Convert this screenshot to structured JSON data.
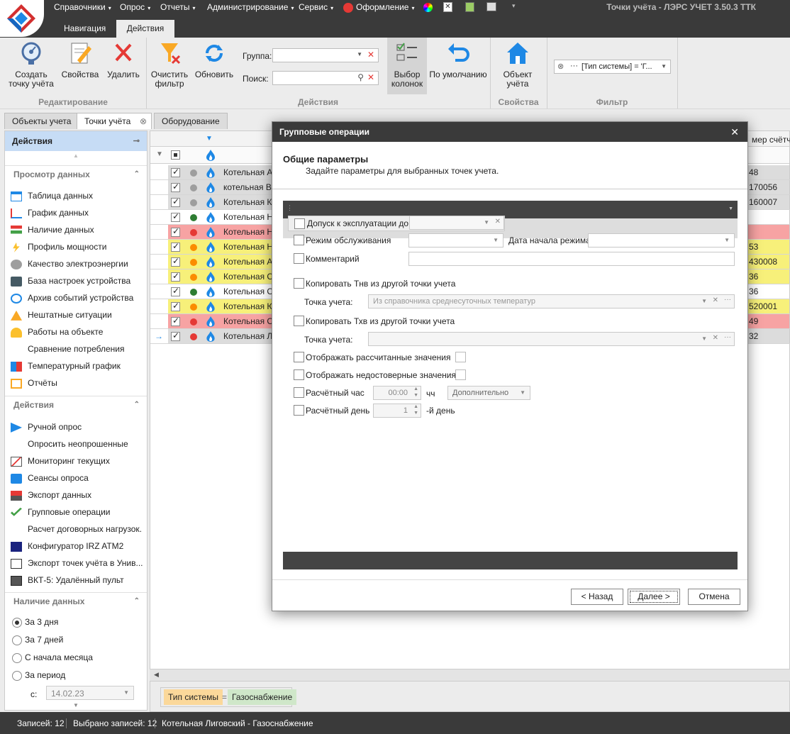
{
  "window": {
    "title": "Точки учёта - ЛЭРС УЧЕТ 3.50.3 ТТК"
  },
  "menu": [
    "Справочники",
    "Опрос",
    "Отчеты",
    "Администрирование",
    "Сервис",
    "Оформление"
  ],
  "ribbon_tabs": [
    "Навигация",
    "Действия"
  ],
  "ribbon": {
    "create": "Создать точку учёта",
    "properties": "Свойства",
    "delete": "Удалить",
    "group_edit": "Редактирование",
    "clear_filter": "Очистить фильтр",
    "refresh": "Обновить",
    "group_label": "Группа:",
    "search_label": "Поиск:",
    "columns": "Выбор колонок",
    "default": "По умолчанию",
    "group_actions": "Действия",
    "object": "Объект учёта",
    "group_props": "Свойства",
    "filter_value": "[Тип системы] = 'Г...",
    "group_filter": "Фильтр"
  },
  "doc_tabs": [
    "Объекты учета",
    "Точки учёта",
    "Оборудование"
  ],
  "left_panel": {
    "header": "Действия",
    "section_view": "Просмотр данных",
    "view_items": [
      "Таблица данных",
      "График данных",
      "Наличие данных",
      "Профиль мощности",
      "Качество электроэнергии",
      "База настроек устройства",
      "Архив событий устройства",
      "Нештатные ситуации",
      "Работы на объекте",
      "Сравнение потребления",
      "Температурный график",
      "Отчёты"
    ],
    "section_actions": "Действия",
    "action_items": [
      "Ручной опрос",
      "Опросить неопрошенные",
      "Мониторинг текущих",
      "Сеансы опроса",
      "Экспорт данных",
      "Групповые операции",
      "Расчет договорных нагрузок.",
      "Конфигуратор IRZ ATM2",
      "Экспорт точек учёта в Унив...",
      "ВКТ-5: Удалённый пульт"
    ],
    "section_avail": "Наличие данных",
    "radios": [
      "За 3 дня",
      "За 7 дней",
      "С начала месяца",
      "За период"
    ],
    "date_label": "с:",
    "date_value": "14.02.23"
  },
  "grid": {
    "col_counter": "мер счётчик",
    "rows": [
      {
        "name": "Котельная А...",
        "num": "48",
        "status": "gray",
        "bg": "#dcdcdc"
      },
      {
        "name": "котельная Во...",
        "num": "170056",
        "status": "gray",
        "bg": "#dcdcdc"
      },
      {
        "name": "Котельная Ко...",
        "num": "160007",
        "status": "gray",
        "bg": "#dcdcdc"
      },
      {
        "name": "Котельная Не...",
        "num": "",
        "status": "green",
        "bg": "#ffffff"
      },
      {
        "name": "Котельная Не...",
        "num": "",
        "status": "red",
        "bg": "#f7a3a3"
      },
      {
        "name": "Котельная Не...",
        "num": "53",
        "status": "orange",
        "bg": "#f7f07a"
      },
      {
        "name": "Котельная А...",
        "num": "430008",
        "status": "orange",
        "bg": "#f7f07a"
      },
      {
        "name": "Котельная Сл...",
        "num": "36",
        "status": "orange",
        "bg": "#f7f07a"
      },
      {
        "name": "Котельная Сл...",
        "num": "36",
        "status": "green",
        "bg": "#ffffff"
      },
      {
        "name": "Котельная Ю...",
        "num": "520001",
        "status": "orange",
        "bg": "#f7f07a"
      },
      {
        "name": "Котельная Со...",
        "num": "49",
        "status": "red",
        "bg": "#f7a3a3"
      },
      {
        "name": "Котельная Ли...",
        "num": "32",
        "status": "red",
        "bg": "#dcdcdc"
      }
    ]
  },
  "filter_chips": {
    "field": "Тип системы",
    "op": "=",
    "value": "Газоснабжение"
  },
  "status": {
    "records": "Записей: 12",
    "selected": "Выбрано записей: 12",
    "current": "Котельная Лиговский - Газоснабжение"
  },
  "dialog": {
    "title": "Групповые операции",
    "heading": "Общие параметры",
    "subheading": "Задайте параметры для выбранных точек учета.",
    "opt_admission": "Допуск к эксплуатации до",
    "opt_mode": "Режим обслуживания",
    "mode_date_label": "Дата начала режима:",
    "opt_comment": "Комментарий",
    "opt_copy_tnv": "Копировать Тнв из другой точки учета",
    "point_label": "Точка учета:",
    "point_placeholder": "Из справочника среднесуточных температур",
    "opt_copy_txv": "Копировать Тхв из другой точки учета",
    "opt_show_calc": "Отображать рассчитанные значения",
    "opt_show_invalid": "Отображать недостоверные значения",
    "opt_calc_hour": "Расчётный час",
    "calc_hour_value": "00:00",
    "hour_unit": "чч",
    "extra_label": "Дополнительно",
    "opt_calc_day": "Расчётный день",
    "calc_day_value": "1",
    "day_suffix": "-й день",
    "btn_back": "< Назад",
    "btn_next": "Далее >",
    "btn_cancel": "Отмена"
  }
}
